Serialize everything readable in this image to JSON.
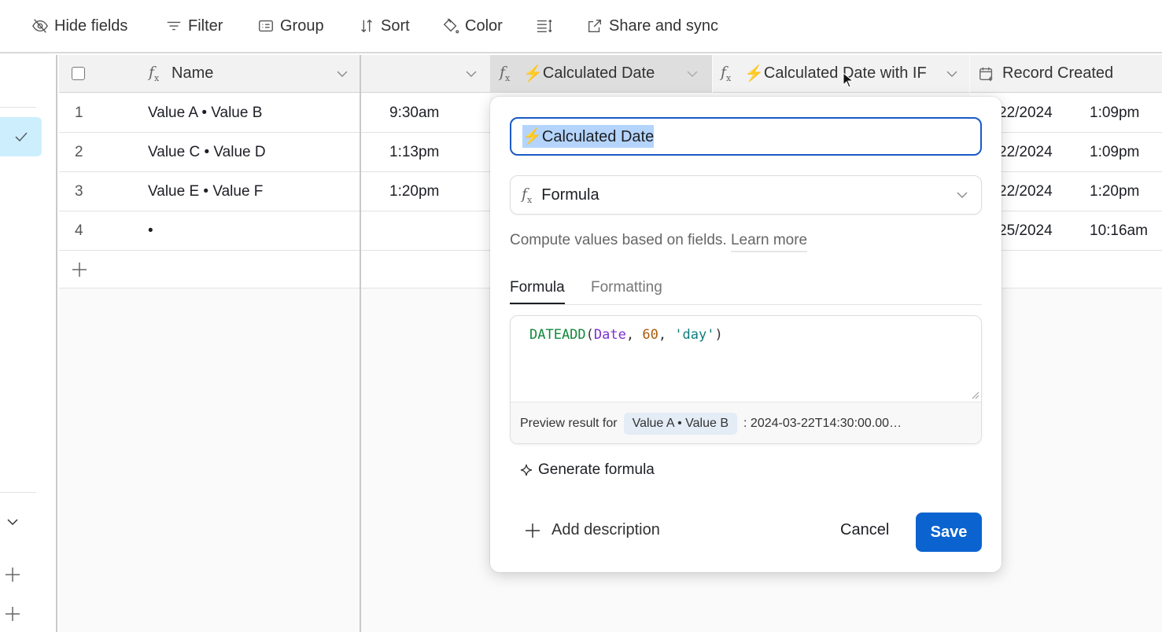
{
  "toolbar": {
    "items": [
      {
        "label": "Hide fields",
        "icon": "eye-slash-icon"
      },
      {
        "label": "Filter",
        "icon": "filter-icon"
      },
      {
        "label": "Group",
        "icon": "group-icon"
      },
      {
        "label": "Sort",
        "icon": "sort-icon"
      },
      {
        "label": "Color",
        "icon": "paint-bucket-icon"
      },
      {
        "label": "",
        "icon": "row-height-icon"
      },
      {
        "label": "Share and sync",
        "icon": "share-icon"
      }
    ]
  },
  "grid": {
    "columns": [
      {
        "label": "Name",
        "icon": "formula-icon"
      },
      {
        "label": ""
      },
      {
        "label": "Calculated Date",
        "icon": "formula-icon",
        "prefix": "⚡"
      },
      {
        "label": "Calculated Date with IF",
        "icon": "formula-icon",
        "prefix": "⚡"
      },
      {
        "label": "Record Created",
        "icon": "calendar-icon"
      }
    ],
    "rows": [
      {
        "num": "1",
        "name": "Value A • Value B",
        "time": "9:30am",
        "created_date": "22/2024",
        "created_time": "1:09pm"
      },
      {
        "num": "2",
        "name": "Value C • Value D",
        "time": "1:13pm",
        "created_date": "22/2024",
        "created_time": "1:09pm"
      },
      {
        "num": "3",
        "name": "Value E • Value F",
        "time": "1:20pm",
        "created_date": "22/2024",
        "created_time": "1:20pm"
      },
      {
        "num": "4",
        "name": "•",
        "time": "",
        "created_date": "25/2024",
        "created_time": "10:16am"
      }
    ],
    "add_row": "+"
  },
  "popover": {
    "field_name": "⚡Calculated Date",
    "field_type": "Formula",
    "help_text": "Compute values based on fields.",
    "learn_more": "Learn more",
    "tabs": [
      {
        "label": "Formula",
        "active": true
      },
      {
        "label": "Formatting",
        "active": false
      }
    ],
    "formula": {
      "fn": "DATEADD",
      "open": "(",
      "field": "Date",
      "sep1": ", ",
      "num": "60",
      "sep2": ", ",
      "str": "'day'",
      "close": ")"
    },
    "preview_label": "Preview result for",
    "preview_record": "Value A • Value B",
    "preview_value": ": 2024-03-22T14:30:00.00…",
    "generate_label": "Generate formula",
    "add_description_label": "Add description",
    "cancel_label": "Cancel",
    "save_label": "Save"
  },
  "colors": {
    "accent": "#0b63d0",
    "focus_border": "#1a5ac6",
    "selection": "#b4d4fb",
    "sidebar_selected": "#cdeffd"
  }
}
